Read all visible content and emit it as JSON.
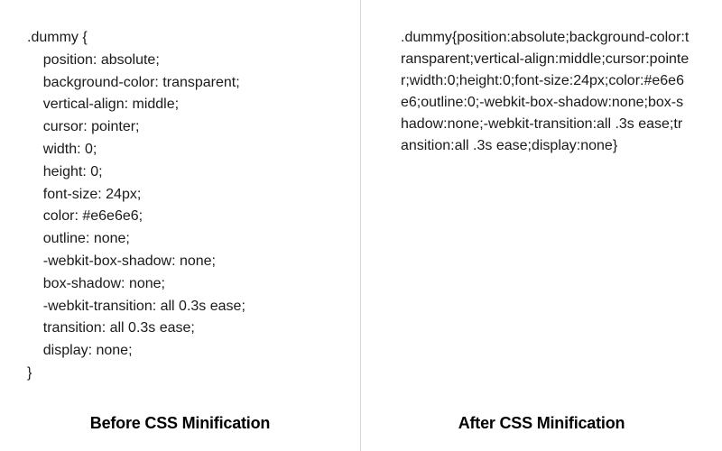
{
  "left": {
    "code": ".dummy {\n    position: absolute;\n    background-color: transparent;\n    vertical-align: middle;\n    cursor: pointer;\n    width: 0;\n    height: 0;\n    font-size: 24px;\n    color: #e6e6e6;\n    outline: none;\n    -webkit-box-shadow: none;\n    box-shadow: none;\n    -webkit-transition: all 0.3s ease;\n    transition: all 0.3s ease;\n    display: none;\n}",
    "caption": "Before CSS Minification"
  },
  "right": {
    "code": ".dummy{position:absolute;background-color:transparent;vertical-align:middle;cursor:pointer;width:0;height:0;font-size:24px;color:#e6e6e6;outline:0;-webkit-box-shadow:none;box-shadow:none;-webkit-transition:all .3s ease;transition:all .3s ease;display:none}",
    "caption": "After CSS Minification"
  }
}
